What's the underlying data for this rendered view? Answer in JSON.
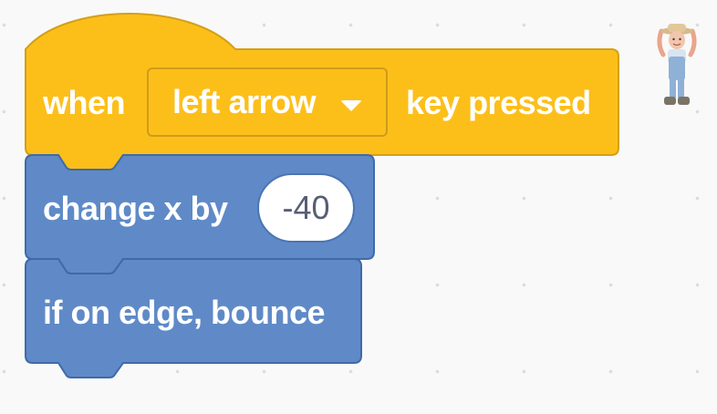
{
  "hat_block": {
    "prefix": "when",
    "key_option": "left arrow",
    "suffix": "key pressed",
    "color": "#ffbf00"
  },
  "motion_block_1": {
    "label": "change x by",
    "value": "-40",
    "color": "#4c97ff"
  },
  "motion_block_2": {
    "label": "if on edge, bounce",
    "color": "#4c97ff"
  },
  "sprite": {
    "icon": "farmer-sprite-icon"
  }
}
